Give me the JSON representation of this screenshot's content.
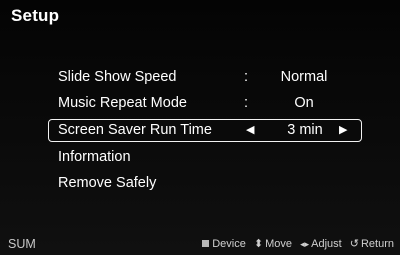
{
  "title": "Setup",
  "menu": {
    "items": [
      {
        "label": "Slide Show Speed",
        "separator": ":",
        "value": "Normal"
      },
      {
        "label": "Music Repeat Mode",
        "separator": ":",
        "value": "On"
      },
      {
        "label": "Screen Saver Run Time",
        "value": "3 min",
        "selected": true
      },
      {
        "label": "Information"
      },
      {
        "label": "Remove Safely"
      }
    ],
    "arrow_left": "◀",
    "arrow_right": "▶"
  },
  "statusbar": {
    "source": "SUM",
    "hints": [
      {
        "icon": "square-icon",
        "label": "Device"
      },
      {
        "icon": "up-down-icon",
        "glyph": "⬍",
        "label": "Move"
      },
      {
        "icon": "left-right-icon",
        "glyph": "◂▸",
        "label": "Adjust"
      },
      {
        "icon": "return-icon",
        "glyph": "↺",
        "label": "Return"
      }
    ]
  }
}
